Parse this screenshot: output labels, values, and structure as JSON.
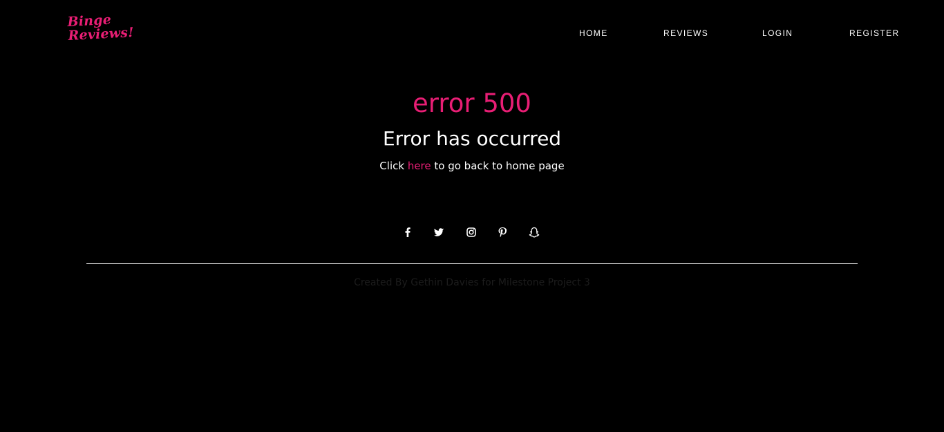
{
  "brand": {
    "line1": "Binge",
    "line2": "Reviews!",
    "color": "#e91e75"
  },
  "nav": {
    "home": "HOME",
    "reviews": "REVIEWS",
    "login": "LOGIN",
    "register": "REGISTER"
  },
  "error": {
    "code": "error 500",
    "title": "Error has occurred",
    "msg_before": "Click ",
    "link": "here",
    "msg_after": " to go back to home page"
  },
  "social": [
    {
      "icon": "facebook-icon"
    },
    {
      "icon": "twitter-icon"
    },
    {
      "icon": "instagram-icon"
    },
    {
      "icon": "pinterest-icon"
    },
    {
      "icon": "snapchat-icon"
    }
  ],
  "footer": {
    "credit": "Created By Gethin Davies for Milestone Project 3"
  },
  "colors": {
    "background": "#000000",
    "accent": "#e91e75",
    "text": "#ffffff"
  }
}
